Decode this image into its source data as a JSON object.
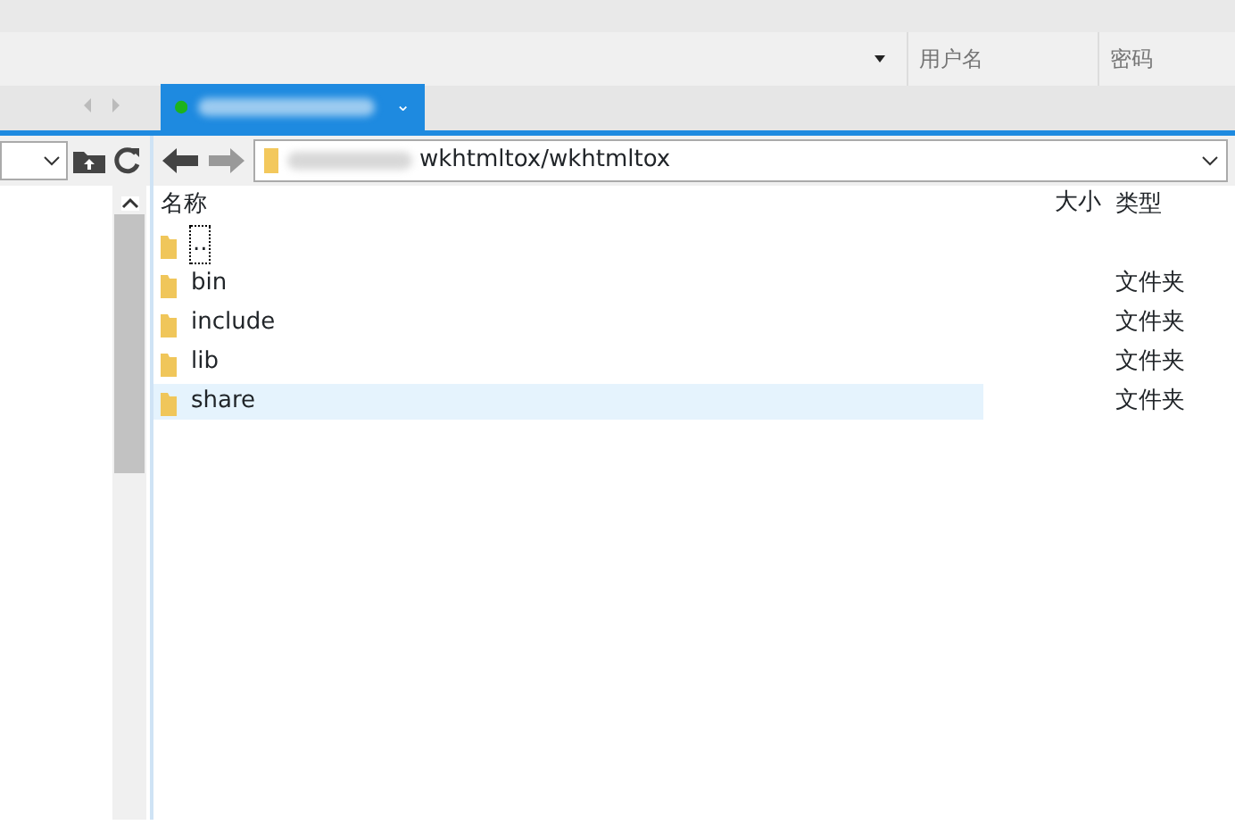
{
  "login_bar": {
    "username_placeholder": "用户名",
    "password_placeholder": "密码"
  },
  "session_tab": {
    "connected": true,
    "selected": true,
    "caret": "⌄"
  },
  "path": {
    "value": "wkhtmltox/wkhtmltox"
  },
  "columns": [
    "名称",
    "大小",
    "类型"
  ],
  "rows": [
    {
      "name": "..",
      "type": "",
      "selected": false,
      "focused": true
    },
    {
      "name": "bin",
      "type": "文件夹",
      "selected": false,
      "focused": false
    },
    {
      "name": "include",
      "type": "文件夹",
      "selected": false,
      "focused": false
    },
    {
      "name": "lib",
      "type": "文件夹",
      "selected": false,
      "focused": false
    },
    {
      "name": "share",
      "type": "文件夹",
      "selected": true,
      "focused": false
    }
  ]
}
